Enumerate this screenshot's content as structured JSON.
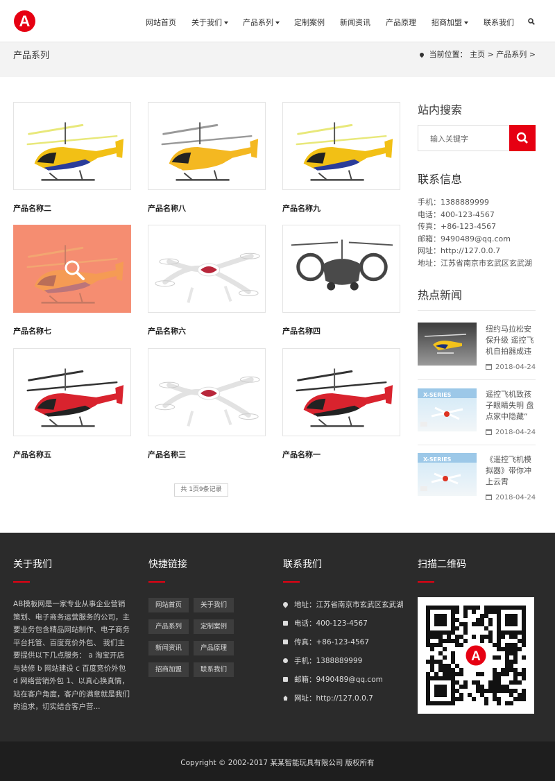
{
  "header": {
    "logo_text": "A",
    "nav": [
      "网站首页",
      "关于我们",
      "产品系列",
      "定制案例",
      "新闻资讯",
      "产品原理",
      "招商加盟",
      "联系我们"
    ],
    "search_icon": "search-icon"
  },
  "banner": {
    "title": "产品系列",
    "crumb_prefix": "当前位置：",
    "crumb": [
      "主页",
      "产品系列"
    ],
    "sep": ">"
  },
  "products": [
    {
      "name": "产品名称二",
      "kind": "heli-yellow-blue"
    },
    {
      "name": "产品名称八",
      "kind": "heli-yellow"
    },
    {
      "name": "产品名称九",
      "kind": "heli-yellow-blue"
    },
    {
      "name": "产品名称七",
      "kind": "heli-yellow-blue"
    },
    {
      "name": "产品名称六",
      "kind": "drone"
    },
    {
      "name": "产品名称四",
      "kind": "heli-gray"
    },
    {
      "name": "产品名称五",
      "kind": "heli-red"
    },
    {
      "name": "产品名称三",
      "kind": "drone"
    },
    {
      "name": "产品名称一",
      "kind": "heli-red"
    }
  ],
  "pager": "共 1页9条记录",
  "sidebar": {
    "search_title": "站内搜索",
    "search_placeholder": "输入关键字",
    "contact_title": "联系信息",
    "contact": [
      "手机：1388889999",
      "电话：400-123-4567",
      "传真：+86-123-4567",
      "邮箱：9490489@qq.com",
      "网址：http://127.0.0.7",
      "地址：江苏省南京市玄武区玄武湖"
    ],
    "news_title": "热点新闻",
    "news": [
      {
        "title": "纽约马拉松安保升级 遥控飞机自拍器成违",
        "date": "2018-04-24"
      },
      {
        "title": "遥控飞机致孩子眼睛失明 盘点家中隐藏“",
        "date": "2018-04-24"
      },
      {
        "title": "《遥控飞机模拟器》带你冲上云霄",
        "date": "2018-04-24"
      }
    ]
  },
  "footer": {
    "about_title": "关于我们",
    "about_text": "AB模板网是一家专业从事企业营销策划、电子商务运营服务的公司，主要业务包含精品网站制作、电子商务平台托管、百度竞价外包、 我们主要提供以下几点服务： a 淘宝开店与装修 b 网站建设 c 百度竞价外包 d 网络营销外包 1、以真心换真情，站在客户角度，客户的满意就是我们的追求，切实结合客户营...",
    "links_title": "快捷链接",
    "links": [
      "网站首页",
      "关于我们",
      "产品系列",
      "定制案例",
      "新闻资讯",
      "产品原理",
      "招商加盟",
      "联系我们"
    ],
    "contact_title": "联系我们",
    "contact": [
      "地址：江苏省南京市玄武区玄武湖",
      "电话：400-123-4567",
      "传真：+86-123-4567",
      "手机：1388889999",
      "邮箱：9490489@qq.com",
      "网址：http://127.0.0.7"
    ],
    "qr_title": "扫描二维码",
    "copyright": "Copyright © 2002-2017 某某智能玩具有限公司 版权所有"
  },
  "colors": {
    "accent": "#e60012",
    "footer_bg": "#2b2b2b",
    "hover_overlay": "#f5917a"
  }
}
